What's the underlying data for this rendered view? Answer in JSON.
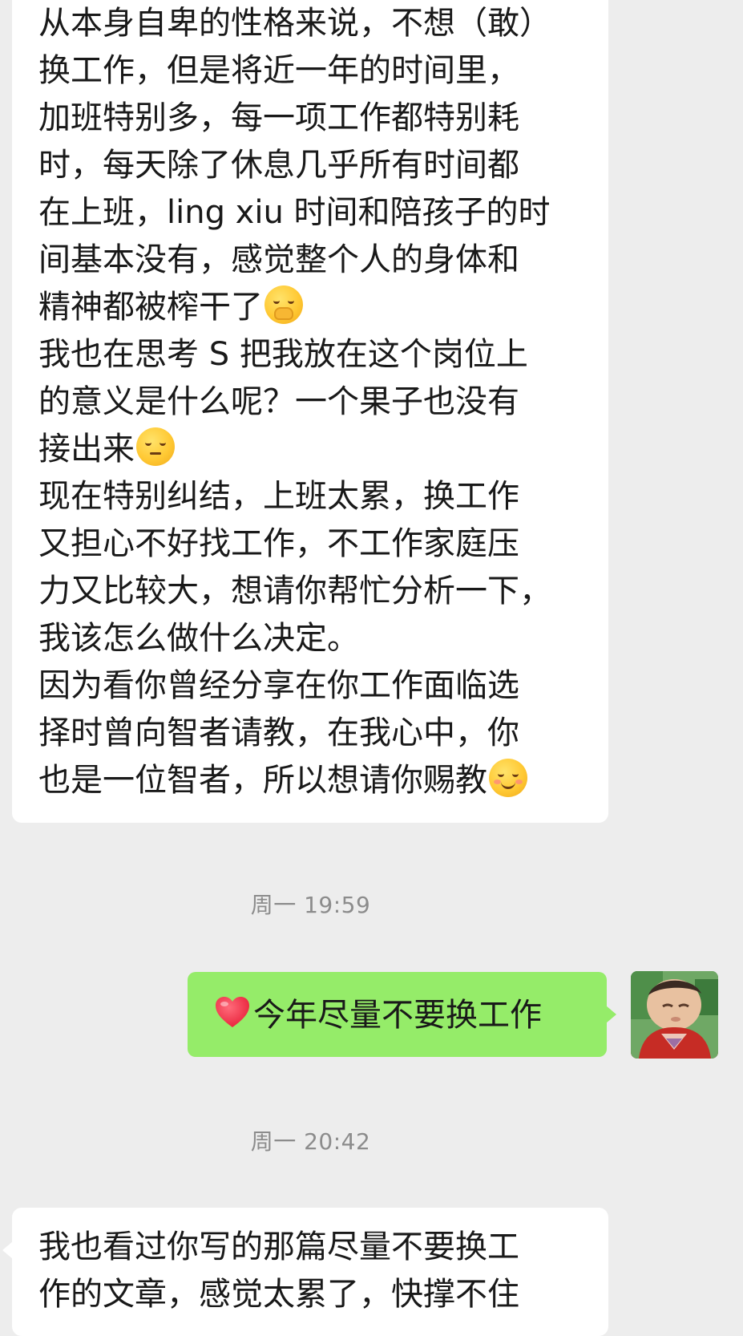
{
  "messages": [
    {
      "lines": [
        "从本身自卑的性格来说，不想（敢）",
        "换工作，但是将近一年的时间里，",
        "加班特别多，每一项工作都特别耗",
        "时，每天除了休息几乎所有时间都",
        "在上班，ling xiu 时间和陪孩子的时",
        "间基本没有，感觉整个人的身体和",
        "精神都被榨干了",
        "我也在思考 S 把我放在这个岗位上",
        "的意义是什么呢？一个果子也没有",
        "接出来",
        "现在特别纠结，上班太累，换工作",
        "又担心不好找工作，不工作家庭压",
        "力又比较大，想请你帮忙分析一下，",
        "我该怎么做什么决定。",
        "因为看你曾经分享在你工作面临选",
        "择时曾向智者请教，在我心中，你",
        "也是一位智者，所以想请你赐教"
      ],
      "emojis": [
        "hand-over-mouth-emoji",
        "pensive-face-emoji",
        "smiling-face-emoji"
      ]
    },
    {
      "timestamp": "周一 19:59"
    },
    {
      "sender": "self",
      "text": "今年尽量不要换工作",
      "emoji": "red-heart-emoji"
    },
    {
      "timestamp": "周一 20:42"
    },
    {
      "lines": [
        "我也看过你写的那篇尽量不要换工",
        "作的文章，感觉太累了，快撑不住"
      ]
    }
  ],
  "colors": {
    "background": "#ededed",
    "incoming_bubble": "#ffffff",
    "outgoing_bubble": "#95ec69",
    "timestamp_text": "#8c8c8c",
    "message_text": "#191919"
  }
}
